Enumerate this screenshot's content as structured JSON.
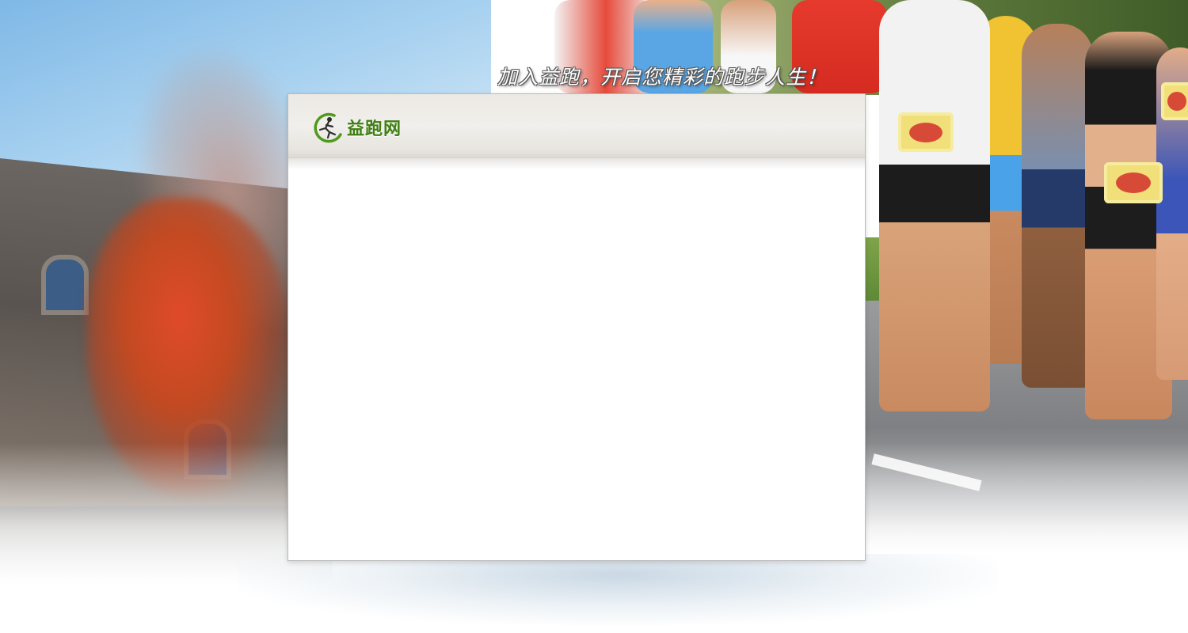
{
  "slogan": "加入益跑，开启您精彩的跑步人生！",
  "logo": {
    "text": "益跑网",
    "icon": "runner-logo-icon",
    "color": "#3f7f12"
  },
  "panel": {
    "header_color": "#ece9e4",
    "body_color": "#ffffff"
  }
}
